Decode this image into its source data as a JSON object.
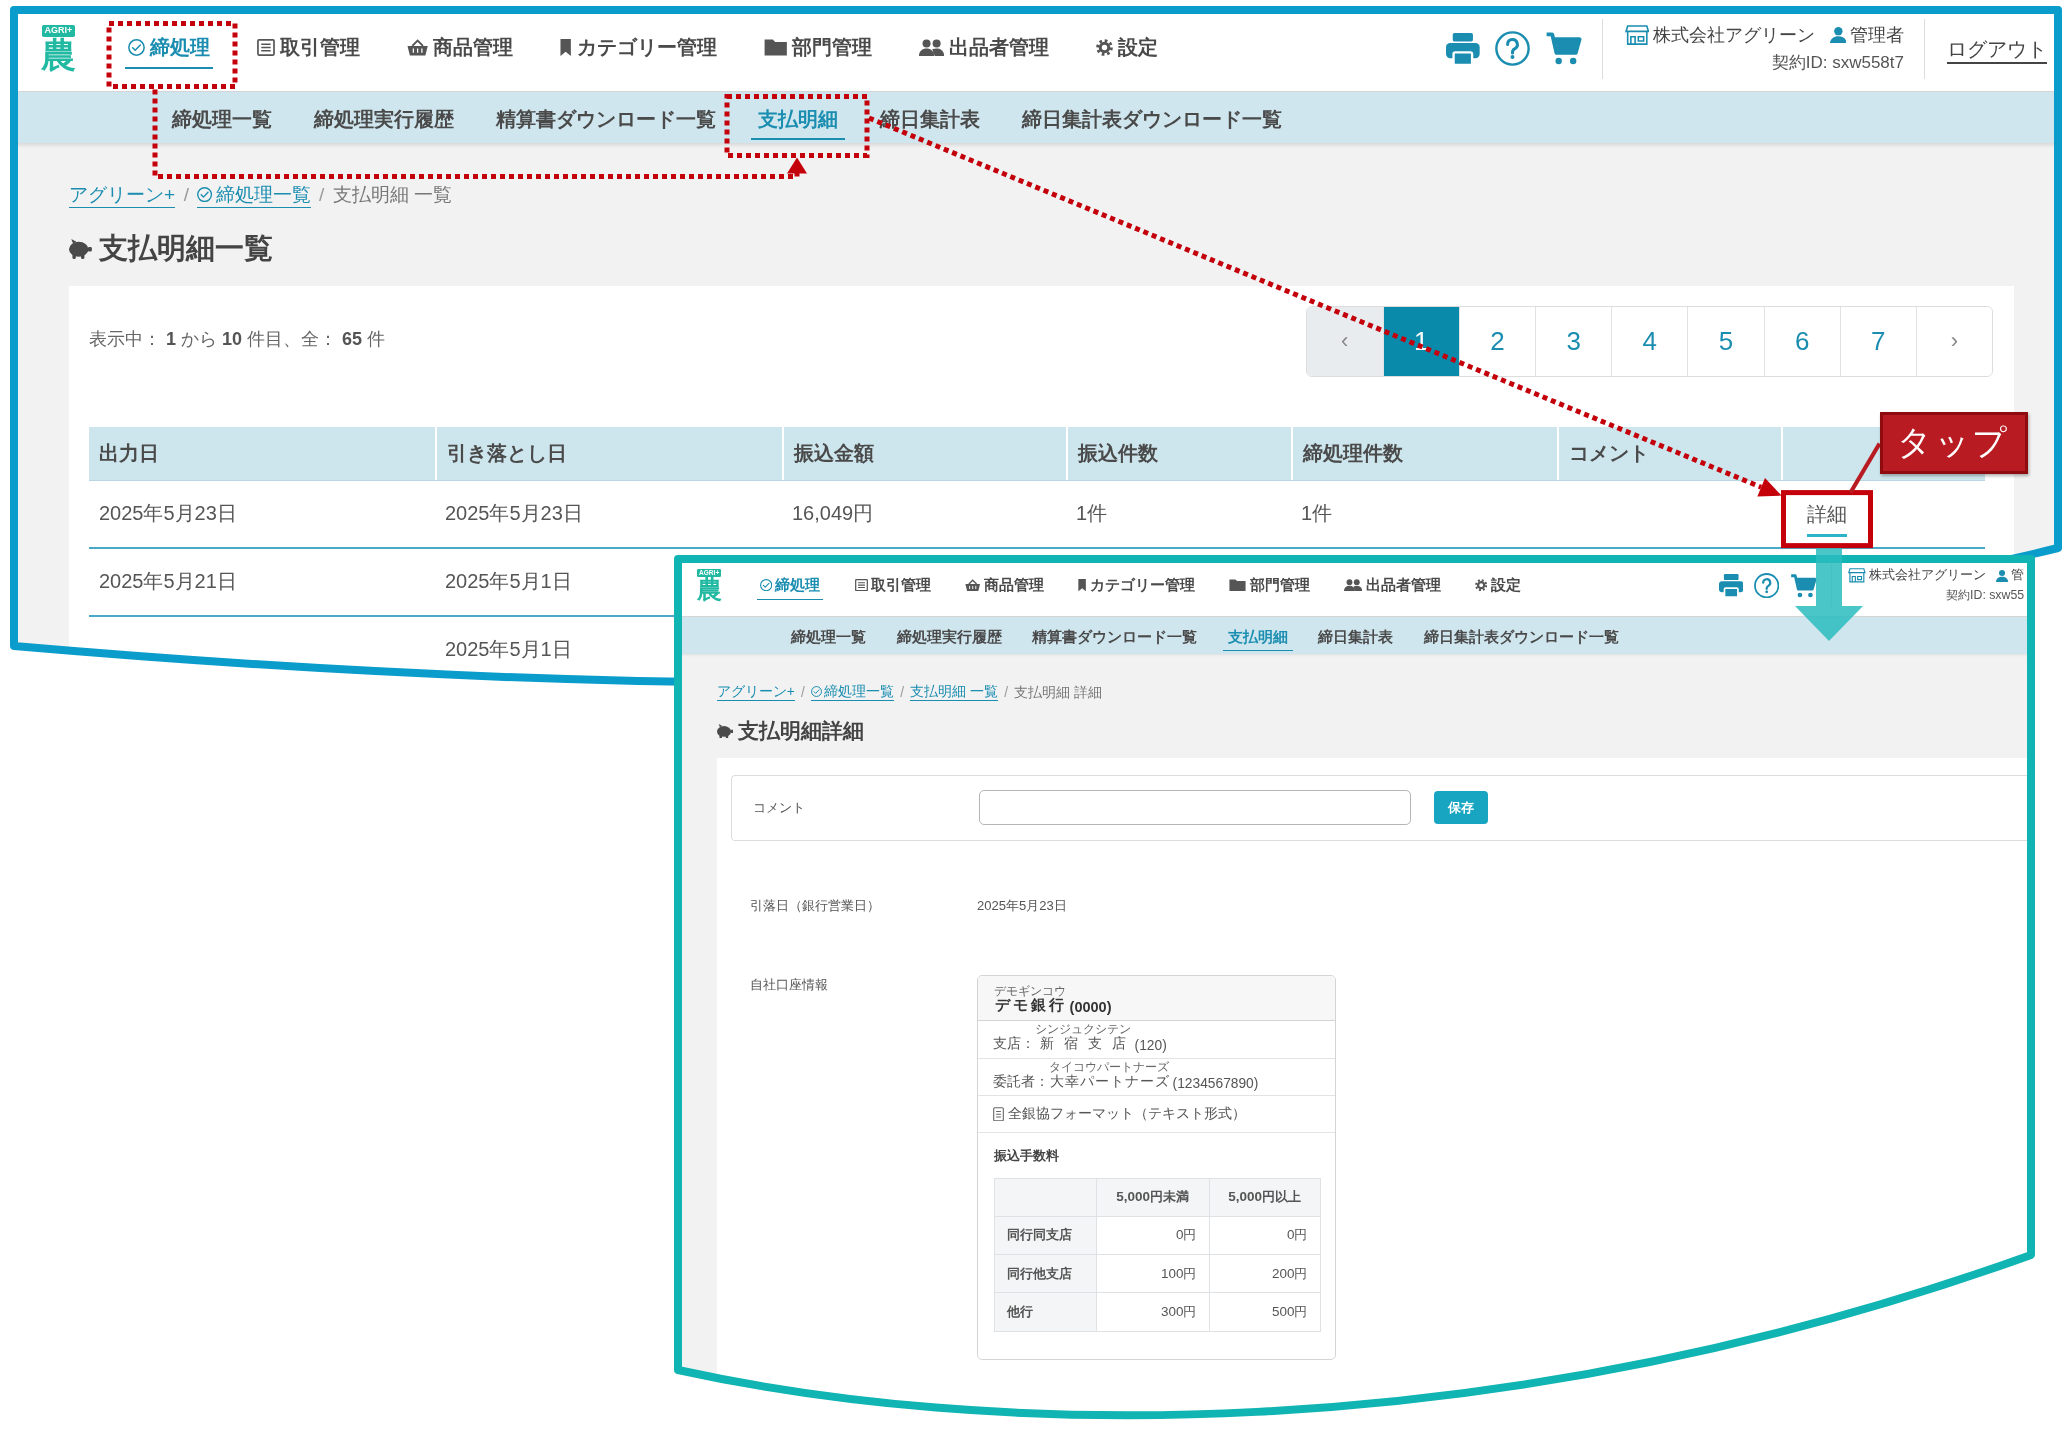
{
  "list_screen": {
    "logo": {
      "tag": "AGRI+",
      "mark": "農"
    },
    "nav": [
      {
        "label": "締処理",
        "selected": true
      },
      {
        "label": "取引管理",
        "selected": false
      },
      {
        "label": "商品管理",
        "selected": false
      },
      {
        "label": "カテゴリー管理",
        "selected": false
      },
      {
        "label": "部門管理",
        "selected": false
      },
      {
        "label": "出品者管理",
        "selected": false
      },
      {
        "label": "設定",
        "selected": false
      }
    ],
    "account": {
      "company": "株式会社アグリーン",
      "user": "管理者",
      "contract_id": "契約ID: sxw558t7",
      "logout": "ログアウト"
    },
    "subnav": [
      {
        "label": "締処理一覧",
        "selected": false
      },
      {
        "label": "締処理実行履歴",
        "selected": false
      },
      {
        "label": "精算書ダウンロード一覧",
        "selected": false
      },
      {
        "label": "支払明細",
        "selected": true
      },
      {
        "label": "締日集計表",
        "selected": false
      },
      {
        "label": "締日集計表ダウンロード一覧",
        "selected": false
      }
    ],
    "breadcrumb": [
      {
        "kind": "link",
        "label": "アグリーン+"
      },
      {
        "kind": "separator",
        "label": "/"
      },
      {
        "kind": "link",
        "label": "締処理一覧"
      },
      {
        "kind": "separator",
        "label": "/"
      },
      {
        "kind": "current",
        "label": "支払明細 一覧"
      }
    ],
    "title": "支払明細一覧",
    "summary": "表示中： **1** から **10** 件目、全： **65** 件",
    "pagination": {
      "previous": "‹",
      "pages": [
        {
          "label": "1",
          "selected": true
        },
        {
          "label": "2",
          "selected": false
        },
        {
          "label": "3",
          "selected": false
        },
        {
          "label": "4",
          "selected": false
        },
        {
          "label": "5",
          "selected": false
        },
        {
          "label": "6",
          "selected": false
        },
        {
          "label": "7",
          "selected": false
        }
      ],
      "next": "›"
    },
    "table": {
      "columns": [
        "出力日",
        "引き落とし日",
        "振込金額",
        "振込件数",
        "締処理件数",
        "コメント"
      ],
      "rows": [
        {
          "output_date": "2025年5月23日",
          "withdrawal_date": "2025年5月23日",
          "amount": "16,049円",
          "transfers": "1件",
          "closings": "1件",
          "action": "詳細"
        },
        {
          "output_date": "2025年5月21日",
          "withdrawal_date": "2025年5月1日"
        },
        {
          "withdrawal_date": "2025年5月1日"
        }
      ]
    }
  },
  "detail_screen": {
    "logo": {
      "tag": "AGRI+",
      "mark": "農"
    },
    "nav": [
      {
        "label": "締処理",
        "selected": true
      },
      {
        "label": "取引管理",
        "selected": false
      },
      {
        "label": "商品管理",
        "selected": false
      },
      {
        "label": "カテゴリー管理",
        "selected": false
      },
      {
        "label": "部門管理",
        "selected": false
      },
      {
        "label": "出品者管理",
        "selected": false
      },
      {
        "label": "設定",
        "selected": false
      }
    ],
    "account": {
      "company": "株式会社アグリーン",
      "user": "管",
      "contract_id": "契約ID: sxw55"
    },
    "subnav": [
      {
        "label": "締処理一覧",
        "selected": false
      },
      {
        "label": "締処理実行履歴",
        "selected": false
      },
      {
        "label": "精算書ダウンロード一覧",
        "selected": false
      },
      {
        "label": "支払明細",
        "selected": true
      },
      {
        "label": "締日集計表",
        "selected": false
      },
      {
        "label": "締日集計表ダウンロード一覧",
        "selected": false
      }
    ],
    "breadcrumb": [
      {
        "kind": "link",
        "label": "アグリーン+"
      },
      {
        "kind": "separator",
        "label": "/"
      },
      {
        "kind": "link",
        "label": "締処理一覧"
      },
      {
        "kind": "separator",
        "label": "/"
      },
      {
        "kind": "link",
        "label": "支払明細 一覧"
      },
      {
        "kind": "separator",
        "label": "/"
      },
      {
        "kind": "current",
        "label": "支払明細 詳細"
      }
    ],
    "title": "支払明細詳細",
    "comment": {
      "label": "コメント",
      "save": "保存"
    },
    "withdrawal": {
      "label": "引落日（銀行営業日）",
      "value": "2025年5月23日"
    },
    "account_info": {
      "label": "自社口座情報",
      "bank": {
        "name": "デモ銀行",
        "reading": "デモギンコウ",
        "code": "(0000)"
      },
      "branch": {
        "label": "支店：",
        "name": "新宿支店",
        "reading": "シンジュクシテン",
        "code": "(120)"
      },
      "consignor": {
        "label": "委託者：",
        "name": "大幸パートナーズ",
        "reading": "タイコウパートナーズ",
        "code": "(1234567890)"
      },
      "format": "全銀協フォーマット（テキスト形式）",
      "fees": {
        "title": "振込手数料",
        "columns": [
          "5,000円未満",
          "5,000円以上"
        ],
        "rows": [
          {
            "label": "同行同支店",
            "values": [
              "0円",
              "0円"
            ]
          },
          {
            "label": "同行他支店",
            "values": [
              "100円",
              "200円"
            ]
          },
          {
            "label": "他行",
            "values": [
              "300円",
              "500円"
            ]
          }
        ]
      }
    }
  },
  "annotations": {
    "callout": "タップ"
  }
}
